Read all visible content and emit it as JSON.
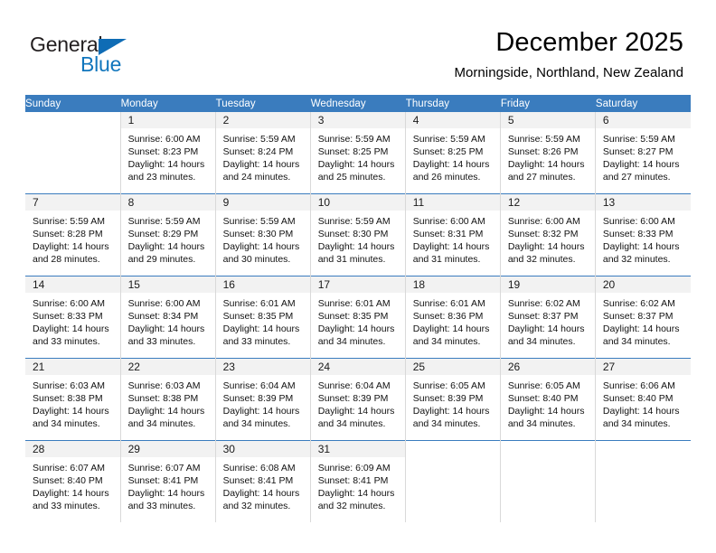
{
  "brand": {
    "name_part1": "General",
    "name_part2": "Blue",
    "accent_color": "#1176bd",
    "triangle_icon": "triangle-icon"
  },
  "header": {
    "title": "December 2025",
    "subtitle": "Morningside, Northland, New Zealand"
  },
  "calendar": {
    "header_bg": "#3a7cbe",
    "daynum_bg": "#f2f2f2",
    "weekdays": [
      "Sunday",
      "Monday",
      "Tuesday",
      "Wednesday",
      "Thursday",
      "Friday",
      "Saturday"
    ],
    "weeks": [
      [
        {
          "day": "",
          "sunrise": "",
          "sunset": "",
          "daylight": "",
          "daylight2": ""
        },
        {
          "day": "1",
          "sunrise": "Sunrise: 6:00 AM",
          "sunset": "Sunset: 8:23 PM",
          "daylight": "Daylight: 14 hours",
          "daylight2": "and 23 minutes."
        },
        {
          "day": "2",
          "sunrise": "Sunrise: 5:59 AM",
          "sunset": "Sunset: 8:24 PM",
          "daylight": "Daylight: 14 hours",
          "daylight2": "and 24 minutes."
        },
        {
          "day": "3",
          "sunrise": "Sunrise: 5:59 AM",
          "sunset": "Sunset: 8:25 PM",
          "daylight": "Daylight: 14 hours",
          "daylight2": "and 25 minutes."
        },
        {
          "day": "4",
          "sunrise": "Sunrise: 5:59 AM",
          "sunset": "Sunset: 8:25 PM",
          "daylight": "Daylight: 14 hours",
          "daylight2": "and 26 minutes."
        },
        {
          "day": "5",
          "sunrise": "Sunrise: 5:59 AM",
          "sunset": "Sunset: 8:26 PM",
          "daylight": "Daylight: 14 hours",
          "daylight2": "and 27 minutes."
        },
        {
          "day": "6",
          "sunrise": "Sunrise: 5:59 AM",
          "sunset": "Sunset: 8:27 PM",
          "daylight": "Daylight: 14 hours",
          "daylight2": "and 27 minutes."
        }
      ],
      [
        {
          "day": "7",
          "sunrise": "Sunrise: 5:59 AM",
          "sunset": "Sunset: 8:28 PM",
          "daylight": "Daylight: 14 hours",
          "daylight2": "and 28 minutes."
        },
        {
          "day": "8",
          "sunrise": "Sunrise: 5:59 AM",
          "sunset": "Sunset: 8:29 PM",
          "daylight": "Daylight: 14 hours",
          "daylight2": "and 29 minutes."
        },
        {
          "day": "9",
          "sunrise": "Sunrise: 5:59 AM",
          "sunset": "Sunset: 8:30 PM",
          "daylight": "Daylight: 14 hours",
          "daylight2": "and 30 minutes."
        },
        {
          "day": "10",
          "sunrise": "Sunrise: 5:59 AM",
          "sunset": "Sunset: 8:30 PM",
          "daylight": "Daylight: 14 hours",
          "daylight2": "and 31 minutes."
        },
        {
          "day": "11",
          "sunrise": "Sunrise: 6:00 AM",
          "sunset": "Sunset: 8:31 PM",
          "daylight": "Daylight: 14 hours",
          "daylight2": "and 31 minutes."
        },
        {
          "day": "12",
          "sunrise": "Sunrise: 6:00 AM",
          "sunset": "Sunset: 8:32 PM",
          "daylight": "Daylight: 14 hours",
          "daylight2": "and 32 minutes."
        },
        {
          "day": "13",
          "sunrise": "Sunrise: 6:00 AM",
          "sunset": "Sunset: 8:33 PM",
          "daylight": "Daylight: 14 hours",
          "daylight2": "and 32 minutes."
        }
      ],
      [
        {
          "day": "14",
          "sunrise": "Sunrise: 6:00 AM",
          "sunset": "Sunset: 8:33 PM",
          "daylight": "Daylight: 14 hours",
          "daylight2": "and 33 minutes."
        },
        {
          "day": "15",
          "sunrise": "Sunrise: 6:00 AM",
          "sunset": "Sunset: 8:34 PM",
          "daylight": "Daylight: 14 hours",
          "daylight2": "and 33 minutes."
        },
        {
          "day": "16",
          "sunrise": "Sunrise: 6:01 AM",
          "sunset": "Sunset: 8:35 PM",
          "daylight": "Daylight: 14 hours",
          "daylight2": "and 33 minutes."
        },
        {
          "day": "17",
          "sunrise": "Sunrise: 6:01 AM",
          "sunset": "Sunset: 8:35 PM",
          "daylight": "Daylight: 14 hours",
          "daylight2": "and 34 minutes."
        },
        {
          "day": "18",
          "sunrise": "Sunrise: 6:01 AM",
          "sunset": "Sunset: 8:36 PM",
          "daylight": "Daylight: 14 hours",
          "daylight2": "and 34 minutes."
        },
        {
          "day": "19",
          "sunrise": "Sunrise: 6:02 AM",
          "sunset": "Sunset: 8:37 PM",
          "daylight": "Daylight: 14 hours",
          "daylight2": "and 34 minutes."
        },
        {
          "day": "20",
          "sunrise": "Sunrise: 6:02 AM",
          "sunset": "Sunset: 8:37 PM",
          "daylight": "Daylight: 14 hours",
          "daylight2": "and 34 minutes."
        }
      ],
      [
        {
          "day": "21",
          "sunrise": "Sunrise: 6:03 AM",
          "sunset": "Sunset: 8:38 PM",
          "daylight": "Daylight: 14 hours",
          "daylight2": "and 34 minutes."
        },
        {
          "day": "22",
          "sunrise": "Sunrise: 6:03 AM",
          "sunset": "Sunset: 8:38 PM",
          "daylight": "Daylight: 14 hours",
          "daylight2": "and 34 minutes."
        },
        {
          "day": "23",
          "sunrise": "Sunrise: 6:04 AM",
          "sunset": "Sunset: 8:39 PM",
          "daylight": "Daylight: 14 hours",
          "daylight2": "and 34 minutes."
        },
        {
          "day": "24",
          "sunrise": "Sunrise: 6:04 AM",
          "sunset": "Sunset: 8:39 PM",
          "daylight": "Daylight: 14 hours",
          "daylight2": "and 34 minutes."
        },
        {
          "day": "25",
          "sunrise": "Sunrise: 6:05 AM",
          "sunset": "Sunset: 8:39 PM",
          "daylight": "Daylight: 14 hours",
          "daylight2": "and 34 minutes."
        },
        {
          "day": "26",
          "sunrise": "Sunrise: 6:05 AM",
          "sunset": "Sunset: 8:40 PM",
          "daylight": "Daylight: 14 hours",
          "daylight2": "and 34 minutes."
        },
        {
          "day": "27",
          "sunrise": "Sunrise: 6:06 AM",
          "sunset": "Sunset: 8:40 PM",
          "daylight": "Daylight: 14 hours",
          "daylight2": "and 34 minutes."
        }
      ],
      [
        {
          "day": "28",
          "sunrise": "Sunrise: 6:07 AM",
          "sunset": "Sunset: 8:40 PM",
          "daylight": "Daylight: 14 hours",
          "daylight2": "and 33 minutes."
        },
        {
          "day": "29",
          "sunrise": "Sunrise: 6:07 AM",
          "sunset": "Sunset: 8:41 PM",
          "daylight": "Daylight: 14 hours",
          "daylight2": "and 33 minutes."
        },
        {
          "day": "30",
          "sunrise": "Sunrise: 6:08 AM",
          "sunset": "Sunset: 8:41 PM",
          "daylight": "Daylight: 14 hours",
          "daylight2": "and 32 minutes."
        },
        {
          "day": "31",
          "sunrise": "Sunrise: 6:09 AM",
          "sunset": "Sunset: 8:41 PM",
          "daylight": "Daylight: 14 hours",
          "daylight2": "and 32 minutes."
        },
        {
          "day": "",
          "sunrise": "",
          "sunset": "",
          "daylight": "",
          "daylight2": ""
        },
        {
          "day": "",
          "sunrise": "",
          "sunset": "",
          "daylight": "",
          "daylight2": ""
        },
        {
          "day": "",
          "sunrise": "",
          "sunset": "",
          "daylight": "",
          "daylight2": ""
        }
      ]
    ]
  }
}
